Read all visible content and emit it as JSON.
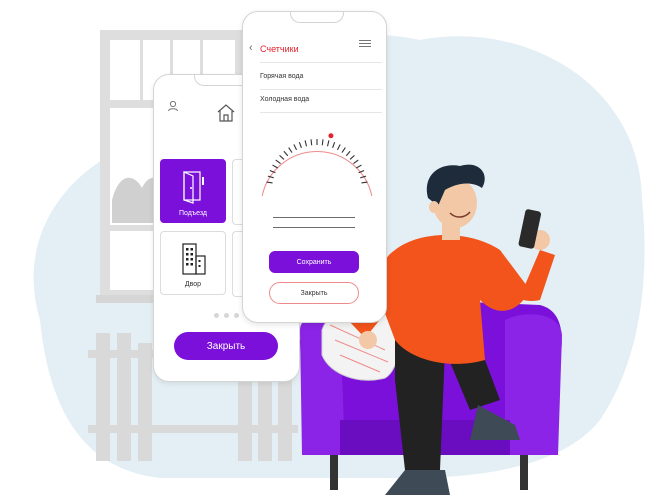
{
  "colors": {
    "accent": "#7a10d9",
    "title_red": "#e2232d",
    "blob": "#e3eff4",
    "shirt": "#f2541b",
    "chair": "#7a10d9"
  },
  "phone_back": {
    "icons": [
      "user-icon",
      "home-icon",
      "door-icon",
      "building-icon"
    ],
    "tiles": [
      {
        "label": "Подъезд",
        "icon": "door-icon"
      },
      {
        "label": "Двор",
        "icon": "building-icon"
      }
    ],
    "close_label": "Закрыть"
  },
  "phone_front": {
    "icons": [
      "chevron-left-icon",
      "menu-icon"
    ],
    "title": "Счетчики",
    "rows": [
      {
        "label": "Горячая вода"
      },
      {
        "label": "Холодная вода"
      }
    ],
    "save_label": "Сохранить",
    "close_label": "Закрыть"
  }
}
